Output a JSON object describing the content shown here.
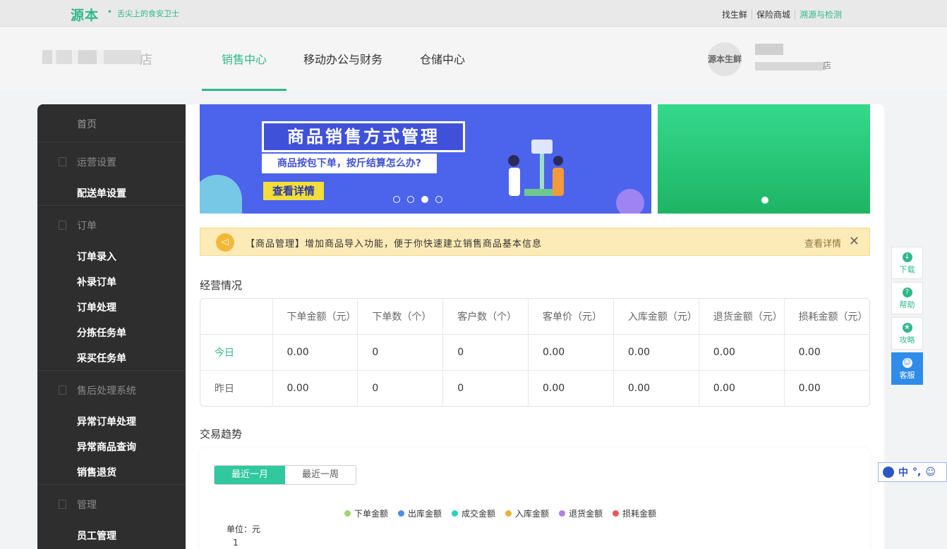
{
  "topbar": {
    "logo": "源本",
    "slogan": "舌尖上的食安卫士",
    "links": [
      "找生鲜",
      "保险商城",
      "溯源与检测"
    ]
  },
  "header": {
    "store_suffix": "店",
    "tabs": [
      "销售中心",
      "移动办公与财务",
      "仓储中心"
    ],
    "active_tab": "销售中心",
    "avatar_text": "源本生鲜",
    "user_suffix": "店"
  },
  "sidebar": {
    "home": "首页",
    "groups": [
      {
        "label": "运营设置",
        "items": [
          "配送单设置"
        ]
      },
      {
        "label": "订单",
        "items": [
          "订单录入",
          "补录订单",
          "订单处理",
          "分拣任务单",
          "采买任务单"
        ]
      },
      {
        "label": "售后处理系统",
        "items": [
          "异常订单处理",
          "异常商品查询",
          "销售退货"
        ]
      },
      {
        "label": "管理",
        "items": [
          "员工管理"
        ]
      }
    ]
  },
  "banner": {
    "title": "商品销售方式管理",
    "subtitle": "商品按包下单，按斤结算怎么办?",
    "button": "查看详情",
    "slide_count": 4,
    "active_slide": 3
  },
  "notice": {
    "text": "【商品管理】增加商品导入功能，便于你快速建立销售商品基本信息",
    "link": "查看详情",
    "close": "✕"
  },
  "stats": {
    "title": "经营情况",
    "columns": [
      "下单金额（元）",
      "下单数（个）",
      "客户数（个）",
      "客单价（元）",
      "入库金额（元）",
      "退货金额（元）",
      "损耗金额（元）"
    ],
    "rows": [
      {
        "label": "今日",
        "values": [
          "0.00",
          "0",
          "0",
          "0.00",
          "0.00",
          "0.00",
          "0.00"
        ]
      },
      {
        "label": "昨日",
        "values": [
          "0.00",
          "0",
          "0",
          "0.00",
          "0.00",
          "0.00",
          "0.00"
        ]
      }
    ]
  },
  "trend": {
    "title": "交易趋势",
    "tabs": [
      "最近一月",
      "最近一周"
    ],
    "active_tab": "最近一月",
    "unit": "单位：元",
    "y_tick": "1",
    "legend": [
      {
        "name": "下单金额",
        "color": "#9ed66b"
      },
      {
        "name": "出库金额",
        "color": "#4a90e2"
      },
      {
        "name": "成交金额",
        "color": "#29d1c0"
      },
      {
        "name": "入库金额",
        "color": "#e8b33a"
      },
      {
        "name": "退货金额",
        "color": "#b97ee3"
      },
      {
        "name": "损耗金额",
        "color": "#e85757"
      }
    ]
  },
  "float_tools": [
    "下载",
    "帮助",
    "攻略",
    "客服"
  ],
  "ime": {
    "lang": "中",
    "punct": "°,",
    "emoji": "☺"
  }
}
